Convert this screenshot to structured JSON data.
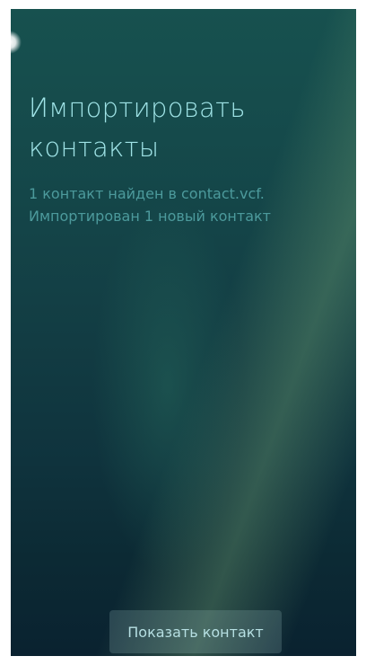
{
  "page": {
    "title_line1": "Импортировать",
    "title_line2": "контакты",
    "message_line1": "1 контакт найден в contact.vcf.",
    "message_line2": "Импортирован 1 новый контакт"
  },
  "actions": {
    "show_contact_label": "Показать контакт"
  }
}
